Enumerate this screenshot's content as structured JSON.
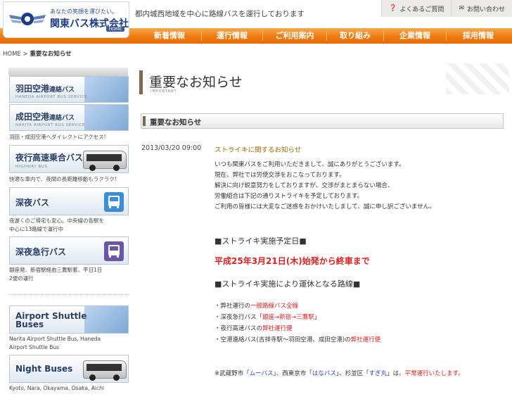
{
  "header": {
    "logo_tagline": "あなたの笑顔を運びたい。",
    "logo_name": "関東バス株式会社",
    "logo_home": "HOME",
    "lead": "都内城西地域を中心に路線バスを運行しております",
    "faq_label": "よくあるご質問",
    "contact_label": "お問い合わせ"
  },
  "nav": [
    "新着情報",
    "運行情報",
    "ご利用案内",
    "取り組み",
    "企業情報",
    "採用情報"
  ],
  "breadcrumb": {
    "home": "HOME",
    "sep": ">",
    "current": "重要なお知らせ"
  },
  "sidebar": {
    "haneda": {
      "jp": "羽田空港",
      "jp_sm": "連絡バス",
      "en": "HANEDA AIRPORT BUS SERVICE"
    },
    "narita": {
      "jp": "成田空港",
      "jp_sm": "連絡バス",
      "en": "NARITA AIRPORT BUS SERVICE"
    },
    "airport_desc": "羽田・成田空港へダイレクトにアクセス!",
    "highway": {
      "jp": "夜行高速乗合バス",
      "en": "HIGHWAY BUS"
    },
    "highway_desc": "快適な車内で、夜間の長距離移動もラクラク!",
    "late": {
      "jp": "深夜バス"
    },
    "late_desc": [
      "夜遅くのご帰宅も安心。中央線の各駅を",
      "中心に13路線で運行中"
    ],
    "late_express": {
      "jp": "深夜急行バス"
    },
    "late_express_desc": [
      "銀座発、新宿駅経由三鷹駅着、平日1日",
      "2便の運行"
    ],
    "shuttle": {
      "line1": "Airport Shuttle",
      "line2": "Buses"
    },
    "shuttle_desc": [
      "Narita Airport Shuttle Bus, Haneda",
      "Airport Shuttle Bus"
    ],
    "night": {
      "label": "Night Buses"
    },
    "night_desc": "Kyoto, Nara, Okayama, Osaka, Aichi"
  },
  "main": {
    "title": "重要なお知らせ",
    "title_en": "IMPORTANT",
    "section": "重要なお知らせ",
    "news": {
      "date": "2013/03/20 09:00",
      "title": "ストライキに関するお知らせ",
      "intro": [
        "いつも関東バスをご利用いただきまして、誠にありがとうございます。",
        "現在、弊社では労使交渉をおこなっております。",
        "解決に向け鋭意努力をしておりますが、交渉がまとまらない場合、",
        "労働組合は下記の通りストライキを予定しております。",
        "ご利用の皆様には大変なご迷惑をおかけいたしまして、誠に申し訳ございません。"
      ],
      "strike_head": "■ストライキ実施予定日■",
      "strike_date": "平成25年3月21日(木)始発から終車まで",
      "routes_head": "■ストライキ実施により運休となる路線■",
      "routes": [
        {
          "pre": "・弊社運行の",
          "red": "一般路線バス全線",
          "post": ""
        },
        {
          "pre": "・深夜急行バス「",
          "red": "銀座→新宿→三鷹駅",
          "post": "」"
        },
        {
          "pre": "・夜行高速バスの",
          "red": "弊社運行便",
          "post": ""
        },
        {
          "pre": "・空港連絡バス(吉祥寺駅～羽田空港、成田空港)の",
          "red": "弊社運行便",
          "post": ""
        }
      ],
      "note": {
        "p1": "※武蔵野市「",
        "b1": "ムーバス",
        "p2": "」、西東京市「",
        "b2": "はなバス",
        "p3": "」、杉並区「",
        "b3": "すぎ丸",
        "p4": "」は、",
        "red": "平常運行いたします。"
      }
    }
  },
  "colors": {
    "nav_orange": "#ee7a10",
    "brand_blue": "#1b3d87",
    "alert_red": "#e02020",
    "title_brown": "#7a6a50"
  }
}
